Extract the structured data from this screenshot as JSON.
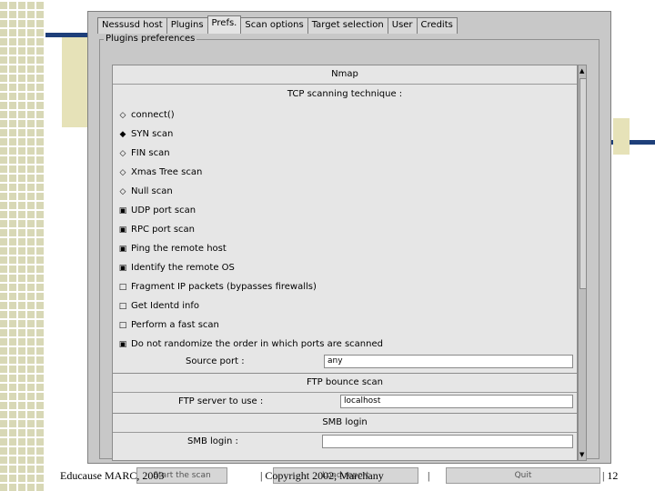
{
  "slide": {
    "footer_left": "Educause MARC, 2003",
    "footer_center": "Copyright 2002, Marchany",
    "page_number": "12",
    "accent_color": "#1e3f7a"
  },
  "window": {
    "tabs": [
      "Nessusd host",
      "Plugins",
      "Prefs.",
      "Scan options",
      "Target selection",
      "User",
      "Credits"
    ],
    "active_tab": "Prefs.",
    "group_title": "Plugins preferences",
    "nmap_header": "Nmap",
    "tcp_header": "TCP scanning technique :",
    "radios": [
      "connect()",
      "SYN scan",
      "FIN scan",
      "Xmas Tree scan",
      "Null scan"
    ],
    "checks": [
      "UDP port scan",
      "RPC port scan",
      "Ping the remote host",
      "Identify the remote OS",
      "Fragment IP packets (bypasses firewalls)",
      "Get Identd info",
      "Perform a fast scan",
      "Do not randomize the order in which ports are scanned"
    ],
    "source_port_label": "Source port :",
    "source_port_value": "any",
    "ftp_header": "FTP bounce scan",
    "ftp_server_label": "FTP server to use :",
    "ftp_server_value": "localhost",
    "smb_header": "SMB login",
    "smb_login_label": "SMB login :",
    "smb_login_value": "",
    "start_button": "Start the scan",
    "load_button": "Load report",
    "quit_button": "Quit"
  }
}
